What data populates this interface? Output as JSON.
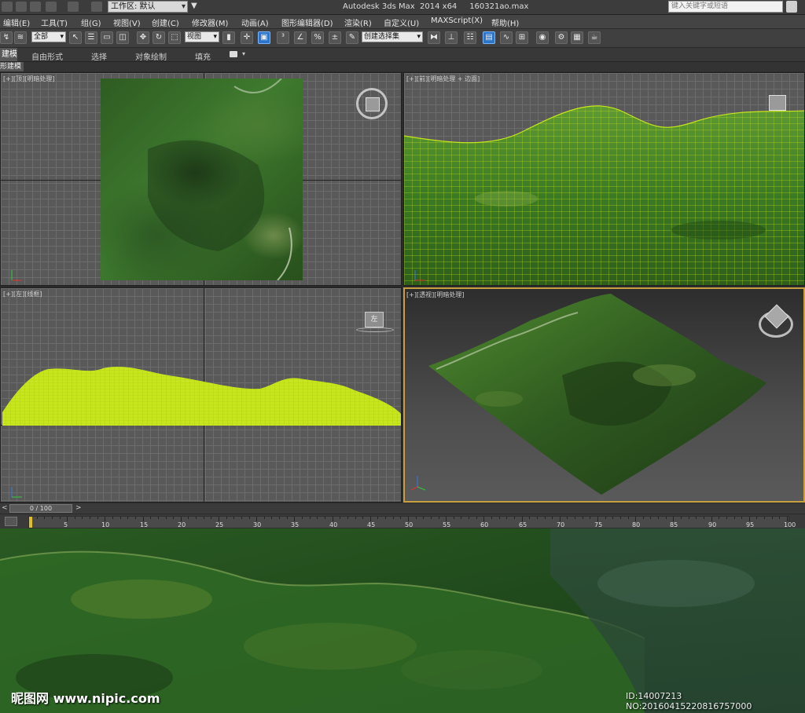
{
  "titlebar": {
    "workspace_label": "工作区: 默认",
    "app_title": "Autodesk 3ds Max  2014 x64     160321ao.max",
    "search_placeholder": "键入关键字或短语"
  },
  "menus": [
    "编辑(E)",
    "工具(T)",
    "组(G)",
    "视图(V)",
    "创建(C)",
    "修改器(M)",
    "动画(A)",
    "图形编辑器(D)",
    "渲染(R)",
    "自定义(U)",
    "MAXScript(X)",
    "帮助(H)"
  ],
  "toolbar": {
    "selection_filter": "全部",
    "reference_coord": "视图",
    "named_selection_placeholder": "创建选择集"
  },
  "ribbon": {
    "tabs": [
      "建模",
      "自由形式",
      "选择",
      "对象绘制",
      "填充"
    ],
    "subtitle": "形建模"
  },
  "viewports": {
    "top": {
      "label_parts": [
        "[+]",
        "[顶]",
        "[明暗处理]"
      ]
    },
    "front": {
      "label_parts": [
        "[+]",
        "[前]",
        "[明暗处理 + 边面]"
      ]
    },
    "left": {
      "label_parts": [
        "[+]",
        "[左]",
        "[线框]"
      ]
    },
    "perspective": {
      "label_parts": [
        "[+]",
        "[透视]",
        "[明暗处理]"
      ]
    }
  },
  "viewcube": {
    "left_face_label": "左"
  },
  "timeline": {
    "frame_display": "0 / 100",
    "current_frame": 0,
    "max_frame": 100,
    "ruler_labels": [
      "5",
      "10",
      "15",
      "20",
      "25",
      "30",
      "35",
      "40",
      "45",
      "50",
      "55",
      "60",
      "65",
      "70",
      "75",
      "80",
      "85",
      "90",
      "95",
      "100"
    ]
  },
  "overlay": {
    "watermark": "昵图网 www.nipic.com",
    "id_text": "ID:14007213 NO:20160415220816757000"
  },
  "colors": {
    "selection_active": "#2a74c9",
    "wireframe": "#c8e61e",
    "viewport_bg": "#595959",
    "perspective_border": "#c8a040",
    "terrain_green": "#3f6e2a"
  }
}
